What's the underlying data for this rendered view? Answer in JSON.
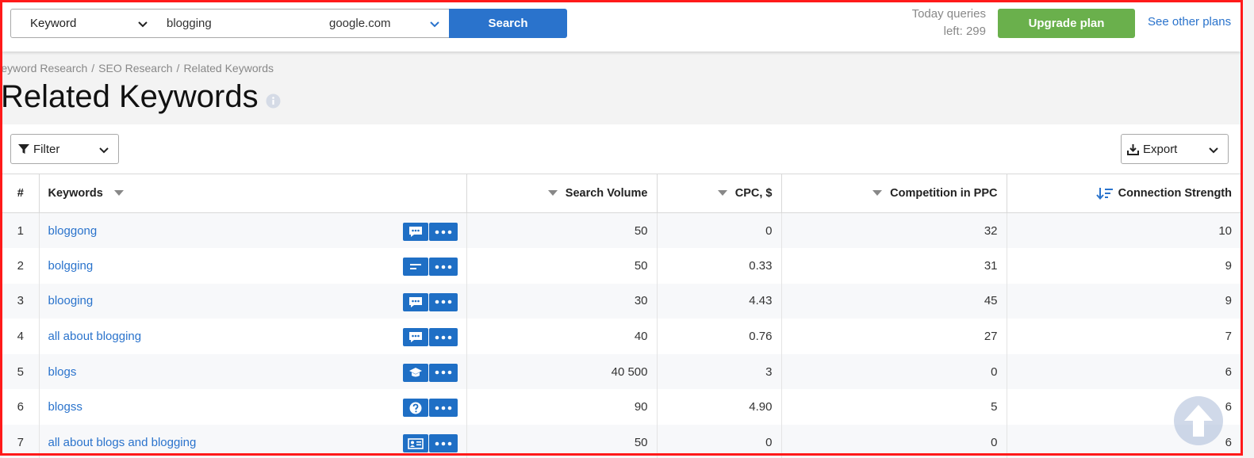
{
  "search": {
    "type_label": "Keyword",
    "query": "blogging",
    "domain": "google.com",
    "search_label": "Search"
  },
  "account": {
    "queries_line1": "Today queries",
    "queries_line2": "left: 299",
    "upgrade_label": "Upgrade plan",
    "other_plans_label": "See other plans"
  },
  "breadcrumb": [
    "Keyword Research",
    "SEO Research",
    "Related Keywords"
  ],
  "page_title": "Related Keywords",
  "toolbar": {
    "filter_label": "Filter",
    "export_label": "Export"
  },
  "table": {
    "headers": {
      "index": "#",
      "keywords": "Keywords",
      "volume": "Search Volume",
      "cpc": "CPC, $",
      "competition": "Competition in PPC",
      "strength": "Connection Strength"
    },
    "rows": [
      {
        "n": "1",
        "keyword": "bloggong",
        "icon": "comment-icon",
        "volume": "50",
        "cpc": "0",
        "competition": "32",
        "strength": "10"
      },
      {
        "n": "2",
        "keyword": "bolgging",
        "icon": "text-lines-icon",
        "volume": "50",
        "cpc": "0.33",
        "competition": "31",
        "strength": "9"
      },
      {
        "n": "3",
        "keyword": "blooging",
        "icon": "comment-icon",
        "volume": "30",
        "cpc": "4.43",
        "competition": "45",
        "strength": "9"
      },
      {
        "n": "4",
        "keyword": "all about blogging",
        "icon": "comment-icon",
        "volume": "40",
        "cpc": "0.76",
        "competition": "27",
        "strength": "7"
      },
      {
        "n": "5",
        "keyword": "blogs",
        "icon": "graduation-cap-icon",
        "volume": "40 500",
        "cpc": "3",
        "competition": "0",
        "strength": "6"
      },
      {
        "n": "6",
        "keyword": "blogss",
        "icon": "question-icon",
        "volume": "90",
        "cpc": "4.90",
        "competition": "5",
        "strength": "6"
      },
      {
        "n": "7",
        "keyword": "all about blogs and blogging",
        "icon": "id-card-icon",
        "volume": "50",
        "cpc": "0",
        "competition": "0",
        "strength": "6"
      }
    ]
  },
  "colors": {
    "primary": "#2a73cc",
    "upgrade": "#6ab04c",
    "frame": "#ff1a1a"
  }
}
